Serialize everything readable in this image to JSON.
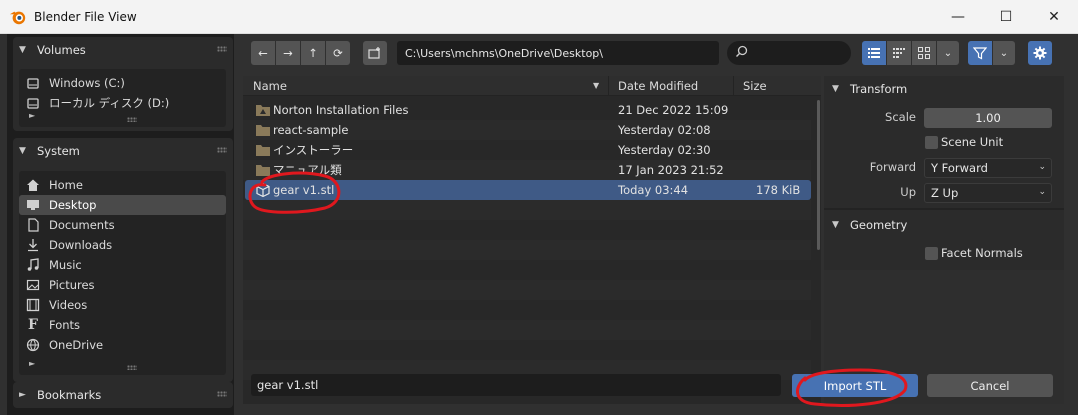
{
  "window": {
    "title": "Blender File View",
    "minimize": "—",
    "maximize": "☐",
    "close": "✕"
  },
  "sidebar": {
    "volumes": {
      "title": "Volumes",
      "items": [
        {
          "label": "Windows (C:)",
          "icon": "drive-icon"
        },
        {
          "label": "ローカル ディスク (D:)",
          "icon": "drive-icon"
        }
      ]
    },
    "system": {
      "title": "System",
      "items": [
        {
          "label": "Home",
          "icon": "home-icon"
        },
        {
          "label": "Desktop",
          "icon": "desktop-icon",
          "active": true
        },
        {
          "label": "Documents",
          "icon": "document-icon"
        },
        {
          "label": "Downloads",
          "icon": "download-icon"
        },
        {
          "label": "Music",
          "icon": "music-icon"
        },
        {
          "label": "Pictures",
          "icon": "picture-icon"
        },
        {
          "label": "Videos",
          "icon": "video-icon"
        },
        {
          "label": "Fonts",
          "icon": "font-icon"
        },
        {
          "label": "OneDrive",
          "icon": "cloud-icon"
        }
      ]
    },
    "bookmarks": {
      "title": "Bookmarks"
    }
  },
  "toolbar": {
    "path": "C:\\Users\\mchms\\OneDrive\\Desktop\\",
    "search_placeholder": ""
  },
  "filelist": {
    "columns": {
      "name": "Name",
      "date": "Date Modified",
      "size": "Size"
    },
    "rows": [
      {
        "name": "Norton Installation Files",
        "date": "21 Dec 2022 15:09",
        "size": "",
        "type": "folder-special"
      },
      {
        "name": "react-sample",
        "date": "Yesterday 02:08",
        "size": "",
        "type": "folder"
      },
      {
        "name": "インストーラー",
        "date": "Yesterday 02:30",
        "size": "",
        "type": "folder"
      },
      {
        "name": "マニュアル類",
        "date": "17 Jan 2023 21:52",
        "size": "",
        "type": "folder"
      },
      {
        "name": "gear v1.stl",
        "date": "Today 03:44",
        "size": "178 KiB",
        "type": "mesh",
        "selected": true
      }
    ]
  },
  "properties": {
    "transform": {
      "title": "Transform",
      "scale_label": "Scale",
      "scale_value": "1.00",
      "scene_unit_label": "Scene Unit",
      "scene_unit_checked": false,
      "forward_label": "Forward",
      "forward_value": "Y Forward",
      "up_label": "Up",
      "up_value": "Z Up"
    },
    "geometry": {
      "title": "Geometry",
      "facet_normals_label": "Facet Normals",
      "facet_normals_checked": false
    }
  },
  "footer": {
    "filename": "gear v1.stl",
    "import_label": "Import STL",
    "cancel_label": "Cancel"
  },
  "colors": {
    "accent": "#4772b3",
    "selection": "#3f5a86",
    "annotation": "#e0181e"
  }
}
